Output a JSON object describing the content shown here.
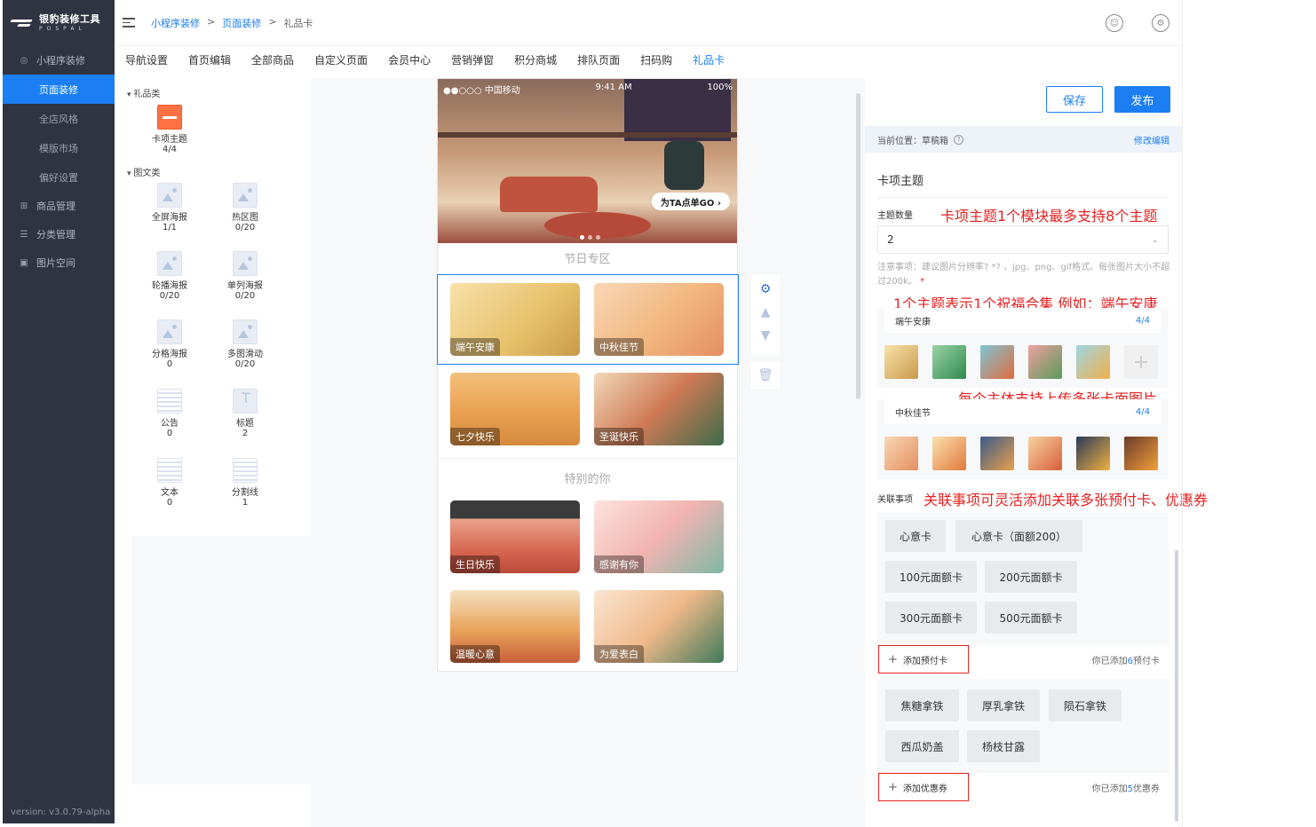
{
  "app": {
    "logo_title": "银豹装修工具",
    "logo_sub": "POSPAL",
    "version": "version: v3.0.79-alpha"
  },
  "sidebar": {
    "section": "小程序装修",
    "subitems": [
      "页面装修",
      "全店风格",
      "模版市场",
      "偏好设置"
    ],
    "items": [
      "商品管理",
      "分类管理",
      "图片空间"
    ]
  },
  "breadcrumb": [
    "小程序装修",
    "页面装修",
    "礼品卡"
  ],
  "tabs": [
    "导航设置",
    "首页编辑",
    "全部商品",
    "自定义页面",
    "会员中心",
    "营销弹窗",
    "积分商城",
    "排队页面",
    "扫码购",
    "礼品卡"
  ],
  "components": {
    "cat1": "礼品类",
    "cat2": "图文类",
    "items": [
      {
        "name": "卡项主题",
        "count": "4/4"
      },
      {
        "name": "全屏海报",
        "count": "1/1"
      },
      {
        "name": "热区图",
        "count": "0/20"
      },
      {
        "name": "轮播海报",
        "count": "0/20"
      },
      {
        "name": "单列海报",
        "count": "0/20"
      },
      {
        "name": "分格海报",
        "count": "0"
      },
      {
        "name": "多图滑动",
        "count": "0/20"
      },
      {
        "name": "公告",
        "count": "0"
      },
      {
        "name": "标题",
        "count": "2"
      },
      {
        "name": "文本",
        "count": "0"
      },
      {
        "name": "分割线",
        "count": "1"
      }
    ]
  },
  "preview": {
    "status_left": "●●○○○ 中国移动",
    "status_time": "9:41 AM",
    "status_battery": "100%",
    "hero_button": "为TA点单GO ›",
    "section1": "节日专区",
    "section2": "特别的你",
    "cards": [
      "端午安康",
      "中秋佳节",
      "七夕快乐",
      "圣诞快乐",
      "生日快乐",
      "感谢有你",
      "温暖心意",
      "为爱表白"
    ]
  },
  "right": {
    "save": "保存",
    "publish": "发布",
    "position_label": "当前位置：草稿箱",
    "edit_link": "修改编辑",
    "section_title": "卡项主题",
    "count_label": "主题数量",
    "count_value": "2",
    "note": "注意事项：建议图片分辨率? *? ，jpg、png、gif格式。每张图片大小不超过200k。",
    "note_req": "*",
    "theme1": {
      "name": "端午安康",
      "count": "4/4"
    },
    "theme2": {
      "name": "中秋佳节",
      "count": "4/4"
    },
    "related_label": "关联事项",
    "prepaid_tags": [
      "心意卡",
      "心意卡（面额200）",
      "100元面额卡",
      "200元面额卡",
      "300元面额卡",
      "500元面额卡"
    ],
    "add_prepaid": "添加预付卡",
    "prepaid_count_pre": "你已添加",
    "prepaid_count_n": "6",
    "prepaid_count_post": "预付卡",
    "coupon_tags": [
      "焦糖拿铁",
      "厚乳拿铁",
      "陨石拿铁",
      "西瓜奶盖",
      "杨枝甘露"
    ],
    "add_coupon": "添加优惠券",
    "coupon_count_pre": "你已添加",
    "coupon_count_n": "5",
    "coupon_count_post": "优惠券"
  },
  "annotations": {
    "a1": "卡项主题1个模块最多支持8个主题",
    "a2": "1个主题表示1个祝福合集 例如：端午安康",
    "a3": "每个主体支持上传多张卡面图片",
    "a4": "关联事项可灵活添加关联多张预付卡、优惠券"
  },
  "colors": {
    "accent": "#1b7ef2",
    "annotation": "#e62222",
    "sidebar": "#2f3440"
  }
}
